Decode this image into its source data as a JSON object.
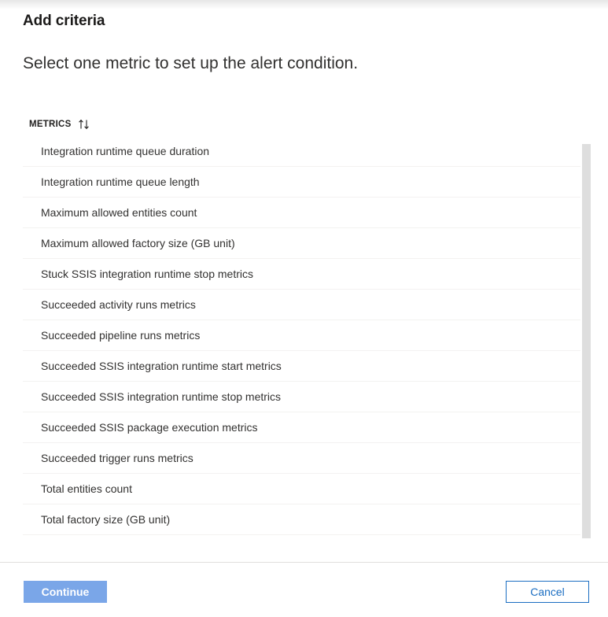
{
  "blade": {
    "title": "Add criteria",
    "subtitle": "Select one metric to set up the alert condition."
  },
  "list": {
    "column_header": "METRICS",
    "sort_icon": "sort-ascending-descending-icon",
    "rows": [
      {
        "label": "Integration runtime queue duration"
      },
      {
        "label": "Integration runtime queue length"
      },
      {
        "label": "Maximum allowed entities count"
      },
      {
        "label": "Maximum allowed factory size (GB unit)"
      },
      {
        "label": "Stuck SSIS integration runtime stop metrics"
      },
      {
        "label": "Succeeded activity runs metrics"
      },
      {
        "label": "Succeeded pipeline runs metrics"
      },
      {
        "label": "Succeeded SSIS integration runtime start metrics"
      },
      {
        "label": "Succeeded SSIS integration runtime stop metrics"
      },
      {
        "label": "Succeeded SSIS package execution metrics"
      },
      {
        "label": "Succeeded trigger runs metrics"
      },
      {
        "label": "Total entities count"
      },
      {
        "label": "Total factory size (GB unit)"
      },
      {
        "label": ""
      }
    ]
  },
  "scrollbar": {
    "name": "metric-list-scrollbar"
  },
  "footer": {
    "continue_label": "Continue",
    "cancel_label": "Cancel"
  },
  "colors": {
    "continue_background": "#7aa6e8",
    "continue_text": "#ffffff",
    "cancel_border": "#1b6ec2",
    "cancel_text": "#1b6ec2",
    "row_divider": "#f3f2f1",
    "scrollbar_thumb": "#dedede",
    "footer_divider": "#e1dfdd",
    "body_text": "#323130"
  }
}
